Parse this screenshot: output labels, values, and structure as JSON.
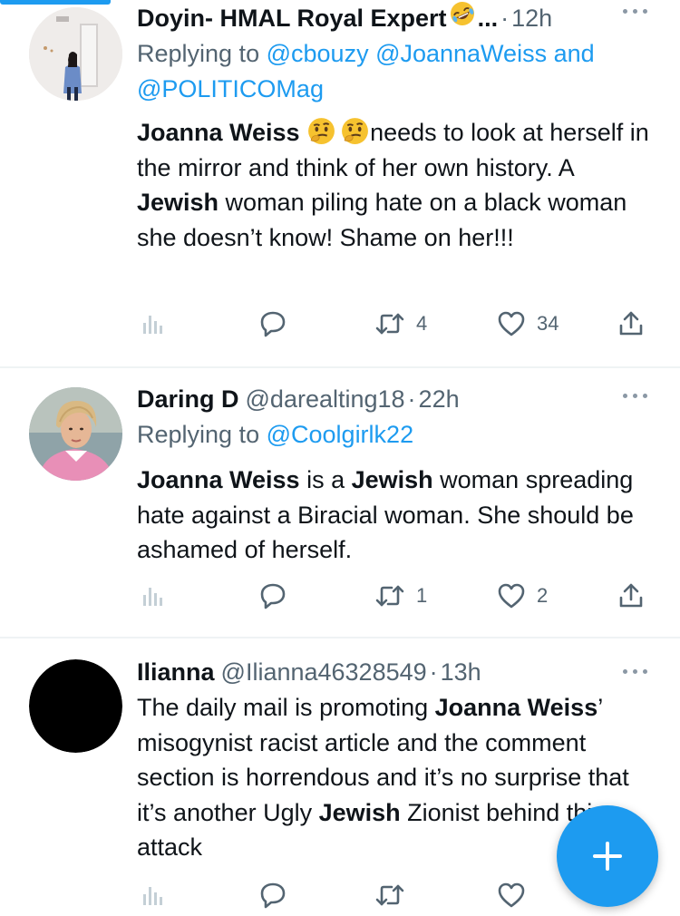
{
  "tweets": [
    {
      "name": "Doyin- HMAL Royal Expert",
      "handle": "",
      "name_suffix": "...",
      "time": "12h",
      "name_emoji": "rolling-on-floor-laughing-emoji",
      "replying_prefix": "Replying to",
      "replying_mentions": "@cbouzy @JoannaWeiss and @POLITICOMag",
      "body_segments": [
        {
          "text": "Joanna Weiss ",
          "bold": true
        },
        {
          "text": "",
          "emoji": "thinking-emoji"
        },
        {
          "text": "",
          "emoji": "thinking-emoji"
        },
        {
          "text": "needs to look at herself in the mirror and think of her own history. A ",
          "bold": false
        },
        {
          "text": "Jewish",
          "bold": true
        },
        {
          "text": " woman piling hate on a black woman she doesn’t know!  Shame on her!!!",
          "bold": false
        }
      ],
      "retweets": "4",
      "likes": "34"
    },
    {
      "name": "Daring D",
      "handle": "@darealting18",
      "time": "22h",
      "replying_prefix": "Replying to",
      "replying_mentions": "@Coolgirlk22",
      "body_segments": [
        {
          "text": "Joanna Weiss",
          "bold": true
        },
        {
          "text": " is a ",
          "bold": false
        },
        {
          "text": "Jewish",
          "bold": true
        },
        {
          "text": " woman spreading hate against a Biracial woman. She should be ashamed of herself.",
          "bold": false
        }
      ],
      "retweets": "1",
      "likes": "2"
    },
    {
      "name": "Ilianna",
      "handle": "@Ilianna46328549",
      "time": "13h",
      "body_segments": [
        {
          "text": "The daily mail is promoting ",
          "bold": false
        },
        {
          "text": "Joanna Weiss",
          "bold": true
        },
        {
          "text": "’ misogynist racist article and the comment section is horrendous and it’s no surprise that it’s another Ugly ",
          "bold": false
        },
        {
          "text": "Jewish",
          "bold": true
        },
        {
          "text": " Zionist behind this attack",
          "bold": false
        }
      ],
      "retweets": "",
      "likes": ""
    }
  ],
  "icons": {
    "analytics": "analytics-icon",
    "reply": "reply-icon",
    "retweet": "retweet-icon",
    "like": "heart-icon",
    "share": "share-icon",
    "more": "more-options-icon",
    "compose": "compose-plus-icon"
  },
  "colors": {
    "accent": "#1d9bf0",
    "text": "#0f1419",
    "secondary": "#536471",
    "divider": "#eff3f4"
  }
}
